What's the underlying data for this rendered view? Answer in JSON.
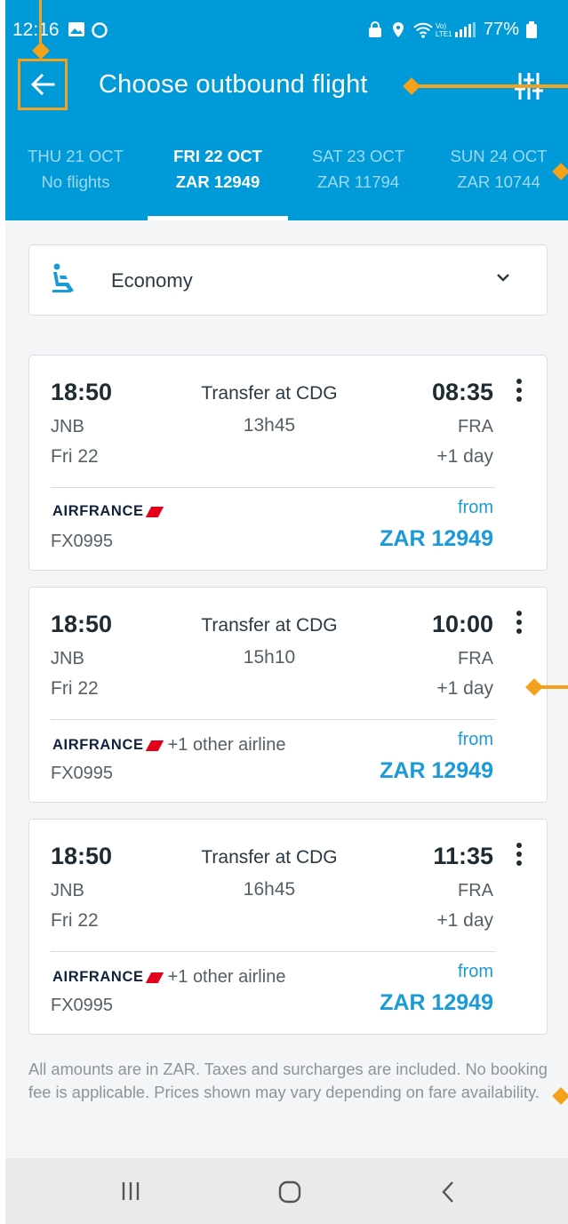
{
  "status_bar": {
    "time": "12:16",
    "battery": "77%",
    "icons": [
      "image-icon",
      "circle-notification-icon",
      "lock-icon",
      "location-icon",
      "wifi-icon",
      "volte-lte-signal-icon",
      "battery-icon"
    ]
  },
  "header": {
    "title": "Choose outbound flight",
    "back_icon": "arrow-left-icon",
    "filter_icon": "sliders-icon",
    "accent_color": "#009ad8"
  },
  "date_tabs": [
    {
      "day": "THU 21 OCT",
      "price": "No  flights",
      "active": false
    },
    {
      "day": "FRI 22 OCT",
      "price": "ZAR 12949",
      "active": true
    },
    {
      "day": "SAT 23 OCT",
      "price": "ZAR 11794",
      "active": false
    },
    {
      "day": "SUN 24 OCT",
      "price": "ZAR 10744",
      "active": false
    }
  ],
  "cabin": {
    "label": "Economy",
    "icon": "seat-icon",
    "chevron": "chevron-down-icon"
  },
  "flights": [
    {
      "dep_time": "18:50",
      "dep_airport": "JNB",
      "dep_date": "Fri 22",
      "transfer": "Transfer at CDG",
      "duration": "13h45",
      "arr_time": "08:35",
      "arr_airport": "FRA",
      "arr_day": "+1 day",
      "airline": "AIRFRANCE",
      "other_airline": "",
      "flight_number": "FX0995",
      "from_label": "from",
      "price": "ZAR 12949"
    },
    {
      "dep_time": "18:50",
      "dep_airport": "JNB",
      "dep_date": "Fri 22",
      "transfer": "Transfer at CDG",
      "duration": "15h10",
      "arr_time": "10:00",
      "arr_airport": "FRA",
      "arr_day": "+1 day",
      "airline": "AIRFRANCE",
      "other_airline": "+1 other airline",
      "flight_number": "FX0995",
      "from_label": "from",
      "price": "ZAR 12949"
    },
    {
      "dep_time": "18:50",
      "dep_airport": "JNB",
      "dep_date": "Fri 22",
      "transfer": "Transfer at CDG",
      "duration": "16h45",
      "arr_time": "11:35",
      "arr_airport": "FRA",
      "arr_day": "+1 day",
      "airline": "AIRFRANCE",
      "other_airline": "+1 other airline",
      "flight_number": "FX0995",
      "from_label": "from",
      "price": "ZAR 12949"
    }
  ],
  "disclaimer": "All amounts are in ZAR. Taxes and surcharges are included. No booking fee is applicable. Prices shown may vary depending on fare availability.",
  "nav_bar": {
    "icons": [
      "recent-apps-icon",
      "home-icon",
      "back-nav-icon"
    ]
  },
  "annotation_color": "#f4a11b"
}
